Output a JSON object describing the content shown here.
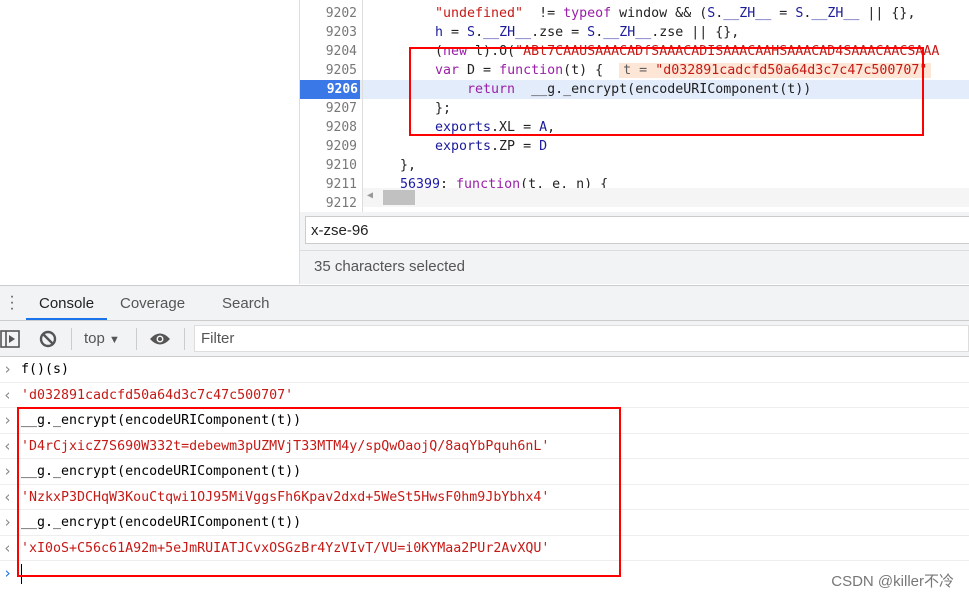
{
  "editor": {
    "lines": [
      {
        "num": "9202",
        "parts": [
          [
            "st",
            "\"undefined\""
          ],
          [
            "",
            "  != "
          ],
          [
            "kw",
            "typeof"
          ],
          [
            "",
            " window && ("
          ],
          [
            "vr",
            "S"
          ],
          [
            "",
            "."
          ],
          [
            "vr",
            "__ZH__"
          ],
          [
            "",
            " = "
          ],
          [
            "vr",
            "S"
          ],
          [
            "",
            "."
          ],
          [
            "vr",
            "__ZH__"
          ],
          [
            "",
            " || {},"
          ]
        ]
      },
      {
        "num": "9203",
        "parts": [
          [
            "vr",
            "h"
          ],
          [
            "",
            " = "
          ],
          [
            "vr",
            "S"
          ],
          [
            "",
            "."
          ],
          [
            "vr",
            "__ZH__"
          ],
          [
            "",
            ".zse = "
          ],
          [
            "vr",
            "S"
          ],
          [
            "",
            "."
          ],
          [
            "vr",
            "__ZH__"
          ],
          [
            "",
            ".zse || {},"
          ]
        ]
      },
      {
        "num": "9204",
        "parts": [
          [
            "",
            "("
          ],
          [
            "kw",
            "new"
          ],
          [
            "",
            " l).O("
          ],
          [
            "st",
            "\"ABt7CAAUSAAACADfSAAACADISAAACAAHSAAACAD4SAAACAACSAAA"
          ]
        ]
      },
      {
        "num": "9205",
        "parts": [
          [
            "kw",
            "var"
          ],
          [
            "",
            " D = "
          ],
          [
            "kw",
            "function"
          ],
          [
            "",
            "(t) {  "
          ]
        ],
        "hint_name": "t = ",
        "hint_value": "\"d032891cadcfd50a64d3c7c47c500707\""
      },
      {
        "num": "9206",
        "current": true,
        "parts": [
          [
            "",
            "    "
          ],
          [
            "kw",
            "return"
          ],
          [
            "",
            "  __g."
          ],
          [
            "",
            "_encrypt("
          ],
          [
            "",
            "encodeURIComponent(t))"
          ]
        ]
      },
      {
        "num": "9207",
        "parts": [
          [
            "",
            "};"
          ]
        ]
      },
      {
        "num": "9208",
        "parts": [
          [
            "vr",
            "exports"
          ],
          [
            "",
            ".XL = "
          ],
          [
            "vr",
            "A"
          ],
          [
            "",
            ","
          ]
        ]
      },
      {
        "num": "9209",
        "parts": [
          [
            "vr",
            "exports"
          ],
          [
            "",
            ".ZP = "
          ],
          [
            "vr",
            "D"
          ]
        ]
      },
      {
        "num": "9210",
        "indent": "out",
        "parts": [
          [
            "",
            "},"
          ]
        ]
      },
      {
        "num": "9211",
        "indent": "out",
        "parts": [
          [
            "nm",
            "56399"
          ],
          [
            "",
            ": "
          ],
          [
            "kw",
            "function"
          ],
          [
            "",
            "(t, e, n) {"
          ]
        ]
      },
      {
        "num": "9212",
        "parts": []
      }
    ]
  },
  "search": {
    "value": "x-zse-96",
    "status": "35 characters selected"
  },
  "drawer": {
    "tabs": [
      "Console",
      "Coverage",
      "Search"
    ],
    "active": "Console"
  },
  "toolbar": {
    "context": "top",
    "filter_placeholder": "Filter"
  },
  "console": [
    {
      "type": "in",
      "text": "f()(s)"
    },
    {
      "type": "out",
      "text": "'d032891cadcfd50a64d3c7c47c500707'"
    },
    {
      "type": "in",
      "text": "__g._encrypt(encodeURIComponent(t))"
    },
    {
      "type": "out",
      "text": "'D4rCjxicZ7S690W332t=debewm3pUZMVjT33MTM4y/spQwOaojQ/8aqYbPquh6nL'"
    },
    {
      "type": "in",
      "text": "__g._encrypt(encodeURIComponent(t))"
    },
    {
      "type": "out",
      "text": "'NzkxP3DCHqW3KouCtqwi1OJ95MiVggsFh6Kpav2dxd+5WeSt5HwsF0hm9JbYbhx4'"
    },
    {
      "type": "in",
      "text": "__g._encrypt(encodeURIComponent(t))"
    },
    {
      "type": "out",
      "text": "'xI0oS+C56c61A92m+5eJmRUIATJCvxOSGzBr4YzVIvT/VU=i0KYMaa2PUr2AvXQU'"
    }
  ],
  "watermark": "CSDN @killer不冷",
  "colors": {
    "highlight_box": "#ff0000",
    "accent": "#1a73e8",
    "string": "#c41a16",
    "keyword": "#9a1fa8"
  }
}
